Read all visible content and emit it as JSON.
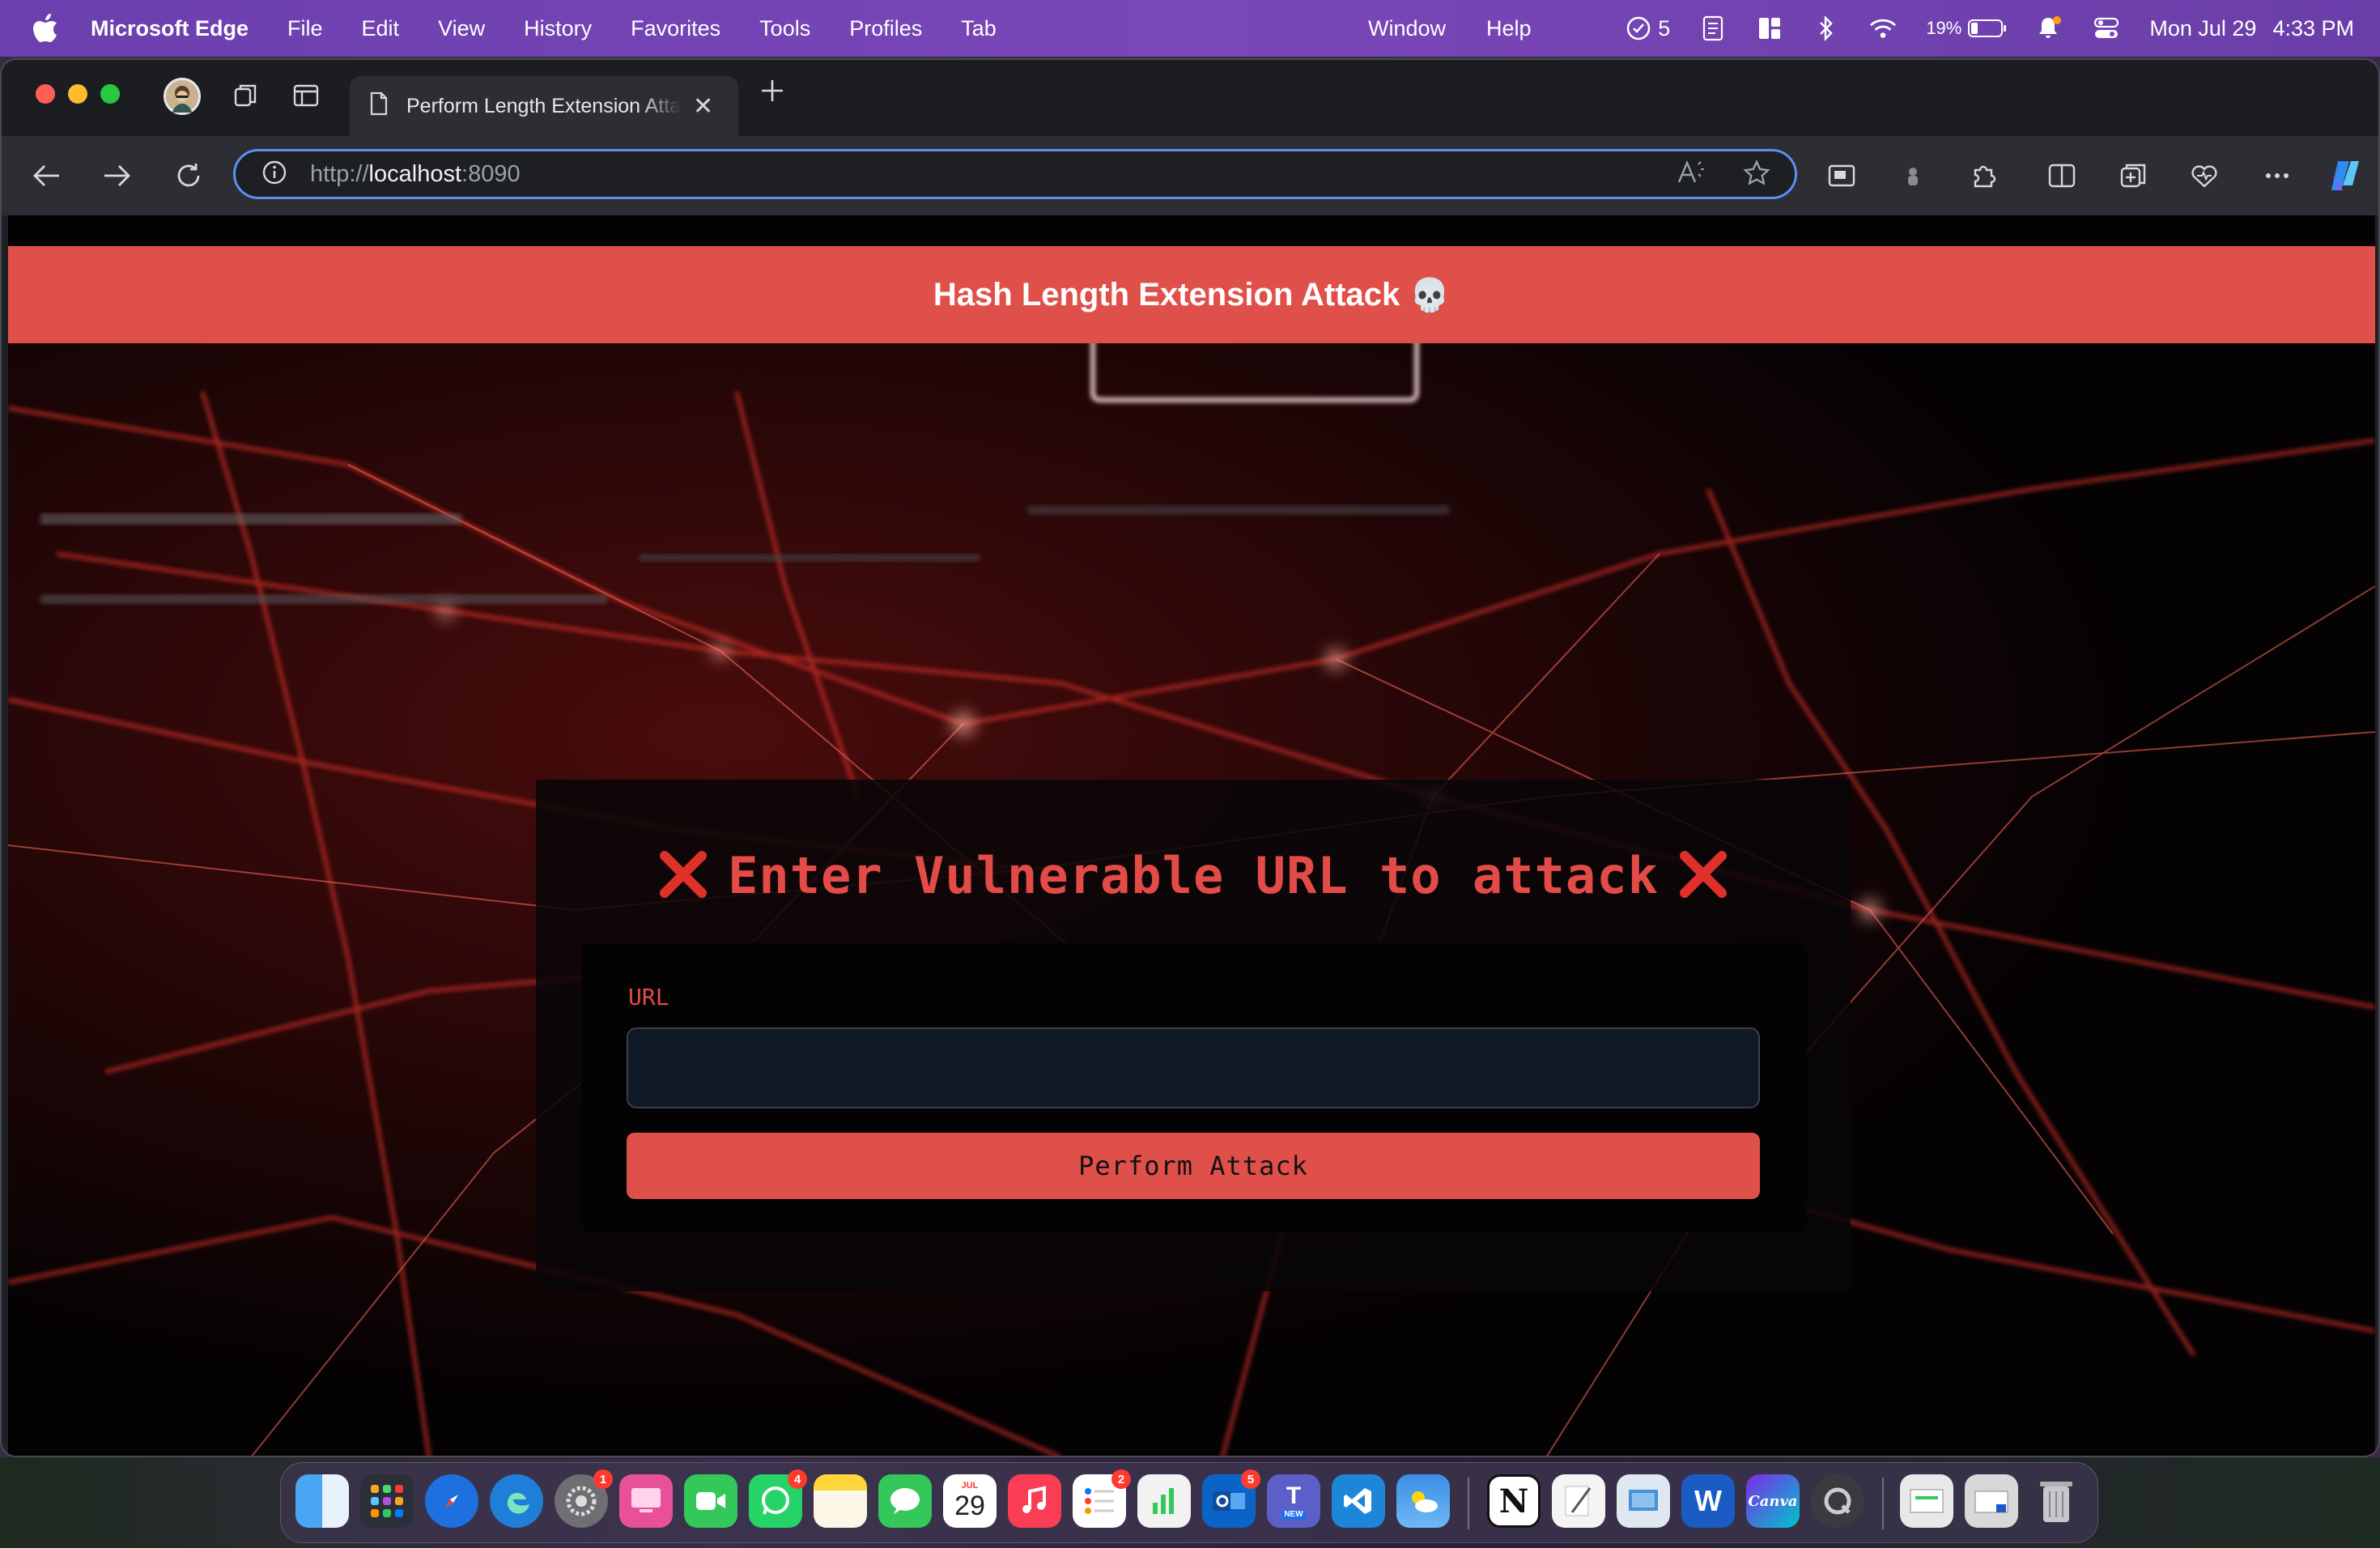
{
  "menubar": {
    "app_name": "Microsoft Edge",
    "items": [
      "File",
      "Edit",
      "View",
      "History",
      "Favorites",
      "Tools",
      "Profiles",
      "Tab"
    ],
    "right_items": [
      "Window",
      "Help"
    ],
    "tasks_count": "5",
    "battery": "19%",
    "date": "Mon Jul 29",
    "time": "4:33 PM"
  },
  "browser": {
    "tab_title": "Perform Length Extension Attack",
    "address": {
      "scheme": "http://",
      "host": "localhost",
      "port": ":8090"
    }
  },
  "page": {
    "header_title": "Hash Length Extension Attack",
    "header_emoji": "💀",
    "card_title": "Enter Vulnerable URL to attack",
    "url_label": "URL",
    "url_value": "",
    "button_label": "Perform Attack",
    "accent_color": "#e0504a"
  },
  "dock": {
    "apps": [
      {
        "name": "finder-icon",
        "badge": ""
      },
      {
        "name": "launchpad-icon",
        "badge": ""
      },
      {
        "name": "safari-icon",
        "badge": ""
      },
      {
        "name": "edge-icon",
        "badge": ""
      },
      {
        "name": "system-settings-icon",
        "badge": "1"
      },
      {
        "name": "screen-sharing-icon",
        "badge": ""
      },
      {
        "name": "facetime-icon",
        "badge": ""
      },
      {
        "name": "whatsapp-icon",
        "badge": "4"
      },
      {
        "name": "notes-icon",
        "badge": ""
      },
      {
        "name": "messages-icon",
        "badge": ""
      },
      {
        "name": "calendar-icon",
        "badge": "",
        "month": "JUL",
        "day": "29"
      },
      {
        "name": "music-icon",
        "badge": ""
      },
      {
        "name": "reminders-icon",
        "badge": "2"
      },
      {
        "name": "numbers-icon",
        "badge": ""
      },
      {
        "name": "outlook-icon",
        "badge": "5"
      },
      {
        "name": "teams-icon",
        "badge": "",
        "tag": "NEW"
      },
      {
        "name": "vscode-icon",
        "badge": ""
      },
      {
        "name": "weather-icon",
        "badge": ""
      },
      {
        "name": "notion-icon",
        "badge": "",
        "label": "N"
      },
      {
        "name": "textedit-icon",
        "badge": ""
      },
      {
        "name": "preview-icon",
        "badge": ""
      },
      {
        "name": "word-icon",
        "badge": "",
        "label": "W"
      },
      {
        "name": "canva-icon",
        "badge": "",
        "label": "Canva"
      },
      {
        "name": "quicktime-icon",
        "badge": ""
      },
      {
        "name": "downloads-stack-icon",
        "badge": ""
      },
      {
        "name": "documents-stack-icon",
        "badge": ""
      },
      {
        "name": "trash-icon",
        "badge": ""
      }
    ]
  }
}
